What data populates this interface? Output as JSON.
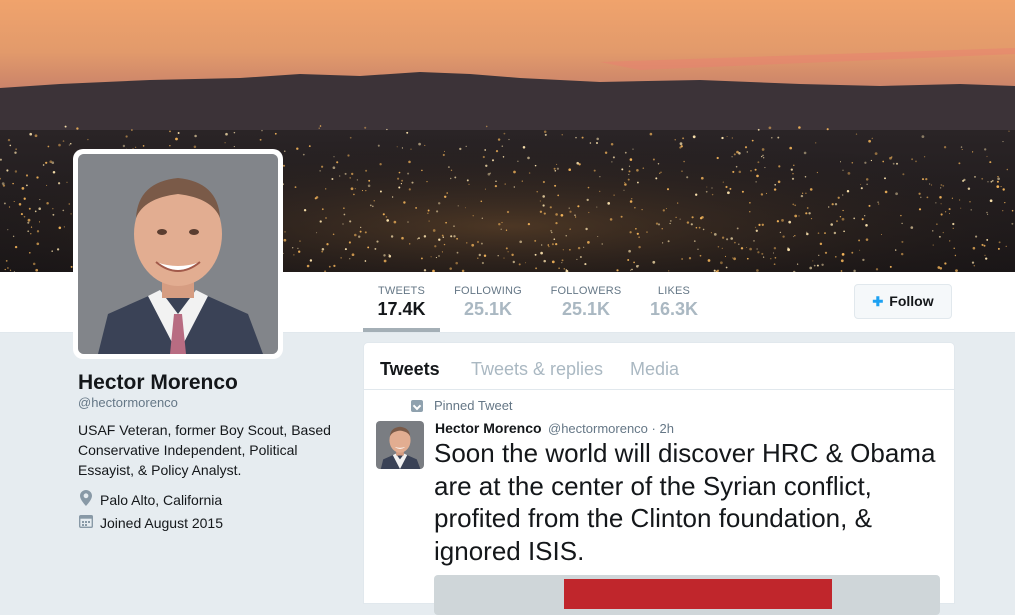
{
  "stats": [
    {
      "label": "TWEETS",
      "value": "17.4K"
    },
    {
      "label": "FOLLOWING",
      "value": "25.1K"
    },
    {
      "label": "FOLLOWERS",
      "value": "25.1K"
    },
    {
      "label": "LIKES",
      "value": "16.3K"
    }
  ],
  "follow_label": "Follow",
  "profile": {
    "name": "Hector Morenco",
    "handle": "@hectormorenco",
    "bio": "USAF Veteran, former Boy Scout, Based Conservative Independent, Political Essayist, & Policy Analyst.",
    "location": "Palo Alto, California",
    "joined": "Joined August 2015"
  },
  "tabs": [
    {
      "label": "Tweets"
    },
    {
      "label": "Tweets & replies"
    },
    {
      "label": "Media"
    }
  ],
  "tweet": {
    "pinned_label": "Pinned Tweet",
    "author_name": "Hector Morenco",
    "author_meta": "@hectormorenco · 2h",
    "text": "Soon the world will discover HRC & Obama are at the center of the Syrian conflict, profited from the Clinton foundation, & ignored ISIS."
  },
  "icons": {
    "follow": "person-add-icon",
    "location": "map-pin-icon",
    "joined": "calendar-icon",
    "pinned": "pin-icon"
  },
  "colors": {
    "accent": "#1da1f2",
    "muted": "#657786",
    "page_bg": "#e6ecf0"
  }
}
